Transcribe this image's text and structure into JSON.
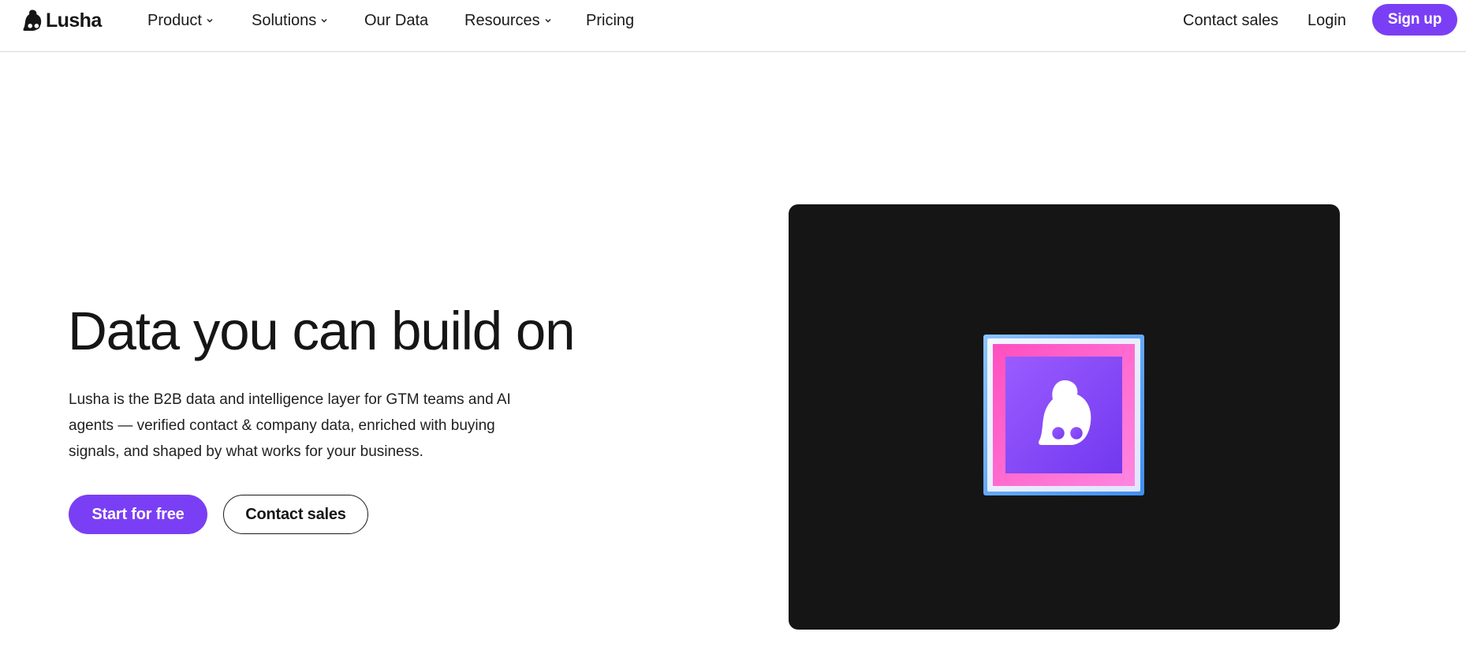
{
  "brand": {
    "name": "Lusha",
    "logo_icon": "lusha-logo-icon",
    "accent_color": "#7a3ff5"
  },
  "nav": {
    "items": [
      {
        "label": "Product",
        "has_dropdown": true
      },
      {
        "label": "Solutions",
        "has_dropdown": true
      },
      {
        "label": "Our Data",
        "has_dropdown": false
      },
      {
        "label": "Resources",
        "has_dropdown": true
      },
      {
        "label": "Pricing",
        "has_dropdown": false
      }
    ],
    "contact_sales": "Contact sales",
    "login": "Login",
    "signup": "Sign up"
  },
  "hero": {
    "title": "Data you can build on",
    "description": "Lusha is the B2B data and intelligence layer for GTM teams and AI agents — verified contact & company data, enriched with buying signals, and shaped by what works for your business.",
    "primary_cta": "Start for free",
    "secondary_cta": "Contact sales"
  },
  "media": {
    "background_color": "#151515",
    "icon": "lusha-app-icon",
    "icon_colors": {
      "outer": "#5aa2f2",
      "pink": "#ff5fc8",
      "purple": "#7b3ff2"
    }
  }
}
